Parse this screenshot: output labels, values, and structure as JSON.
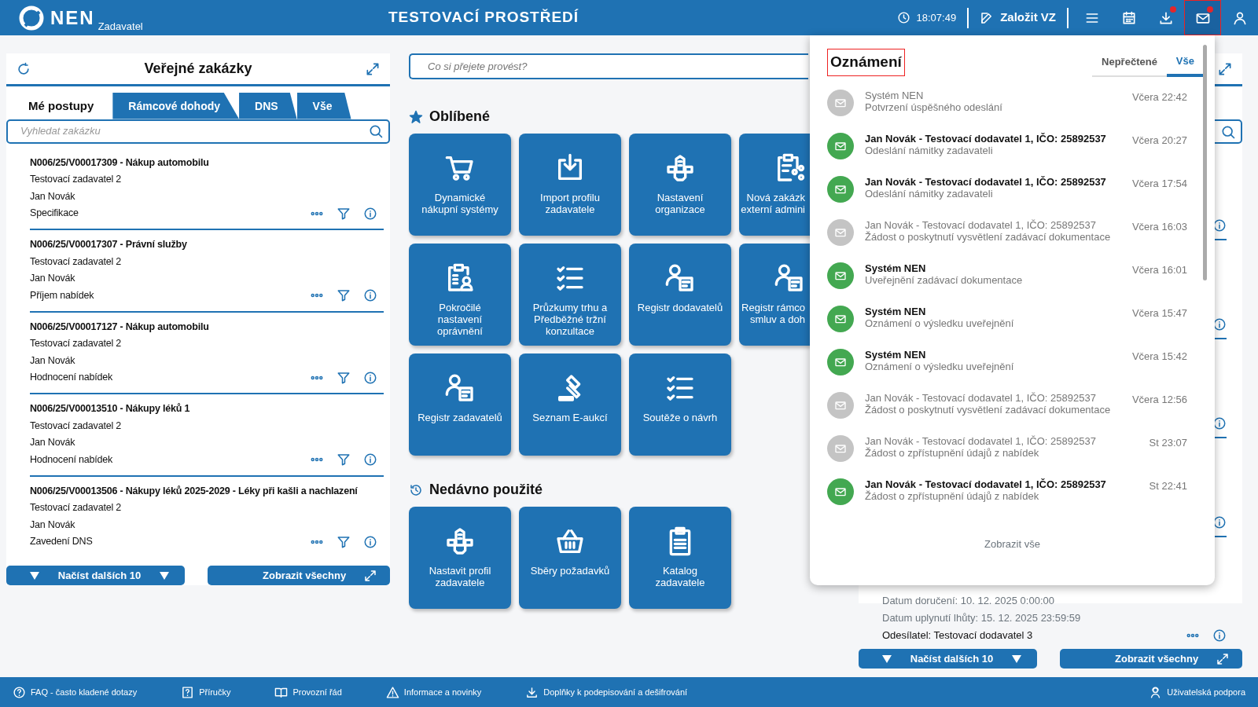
{
  "header": {
    "logo": "NEN",
    "logo_sub": "Zadavatel",
    "env_title": "TESTOVACÍ PROSTŘEDÍ",
    "time": "18:07:49",
    "create_button": "Založit VZ",
    "icon_buttons": [
      {
        "badge": false,
        "selected": false
      },
      {
        "badge": false,
        "selected": false
      },
      {
        "badge": true,
        "selected": false
      },
      {
        "badge": true,
        "selected": true
      },
      {
        "badge": false,
        "selected": false
      }
    ]
  },
  "left_panel": {
    "title": "Veřejné zakázky",
    "tabs": [
      {
        "label": "Mé postupy",
        "selected": true
      },
      {
        "label": "Rámcové dohody",
        "selected": false
      },
      {
        "label": "DNS",
        "selected": false
      },
      {
        "label": "Vše",
        "selected": false
      }
    ],
    "search": {
      "placeholder": "Vyhledat zakázku"
    },
    "items": [
      {
        "title": "N006/25/V00017309 - Nákup automobilu",
        "org": "Testovací zadavatel 2",
        "person": "Jan Novák",
        "phase": "Specifikace"
      },
      {
        "title": "N006/25/V00017307 - Právní služby",
        "org": "Testovací zadavatel 2",
        "person": "Jan Novák",
        "phase": "Příjem nabídek"
      },
      {
        "title": "N006/25/V00017127 - Nákup automobilu",
        "org": "Testovací zadavatel 2",
        "person": "Jan Novák",
        "phase": "Hodnocení nabídek"
      },
      {
        "title": "N006/25/V00013510 - Nákupy léků 1",
        "org": "Testovací zadavatel 2",
        "person": "Jan Novák",
        "phase": "Hodnocení nabídek"
      },
      {
        "title": "N006/25/V00013506 - Nákupy léků 2025-2029 - Léky při kašli a nachlazení",
        "org": "Testovací zadavatel 2",
        "person": "Jan Novák",
        "phase": "Zavedení DNS"
      }
    ],
    "load_more": "Načíst dalších 10",
    "show_all": "Zobrazit všechny"
  },
  "center": {
    "search": {
      "placeholder": "Co si přejete provést?"
    },
    "favorites": {
      "title": "Oblíbené",
      "tiles": [
        {
          "label": "Dynamické nákupní systémy",
          "cut": false
        },
        {
          "label": "Import profilu zadavatele",
          "cut": false
        },
        {
          "label": "Nastavení organizace",
          "cut": false
        },
        {
          "label": "Nová zakázk\nexterní admini",
          "cut": true
        },
        {
          "label": "Pokročilé nastavení oprávnění",
          "cut": false
        },
        {
          "label": "Průzkumy trhu a Předběžné tržní konzultace",
          "cut": false
        },
        {
          "label": "Registr dodavatelů",
          "cut": false
        },
        {
          "label": "Registr rámco\nsmluv a doh",
          "cut": true
        },
        {
          "label": "Registr zadavatelů",
          "cut": false
        },
        {
          "label": "Seznam E-aukcí",
          "cut": false
        },
        {
          "label": "Soutěže o návrh",
          "cut": false
        }
      ]
    },
    "recent": {
      "title": "Nedávno použité",
      "tiles": [
        {
          "label": "Nastavit profil zadavatele",
          "cut": false
        },
        {
          "label": "Sběry požadavků",
          "cut": false
        },
        {
          "label": "Katalog zadavatele",
          "cut": false
        }
      ]
    }
  },
  "right_panel": {
    "delivered": "Datum doručení: 10. 12. 2025 0:00:00",
    "deadline": "Datum uplynutí lhůty: 15. 12. 2025 23:59:59",
    "sender": "Odesílatel: Testovací dodavatel 3",
    "load_more": "Načíst dalších 10",
    "show_all": "Zobrazit všechny"
  },
  "notifications": {
    "title": "Oznámení",
    "tabs": [
      {
        "label": "Nepřečtené",
        "selected": false
      },
      {
        "label": "Vše",
        "selected": true
      }
    ],
    "items": [
      {
        "sender": "Systém NEN",
        "subject": "Potvrzení úspěšného odeslání",
        "time": "Včera 22:42",
        "unread": false
      },
      {
        "sender": "Jan Novák - Testovací dodavatel 1, IČO: 25892537",
        "subject": "Odeslání námitky zadavateli",
        "time": "Včera 20:27",
        "unread": true
      },
      {
        "sender": "Jan Novák - Testovací dodavatel 1, IČO: 25892537",
        "subject": "Odeslání námitky zadavateli",
        "time": "Včera 17:54",
        "unread": true
      },
      {
        "sender": "Jan Novák - Testovací dodavatel 1, IČO: 25892537",
        "subject": "Žádost o poskytnutí vysvětlení zadávací dokumentace",
        "time": "Včera 16:03",
        "unread": false
      },
      {
        "sender": "Systém NEN",
        "subject": "Uveřejnění zadávací dokumentace",
        "time": "Včera 16:01",
        "unread": true
      },
      {
        "sender": "Systém NEN",
        "subject": "Oznámení o výsledku uveřejnění",
        "time": "Včera 15:47",
        "unread": true
      },
      {
        "sender": "Systém NEN",
        "subject": "Oznámení o výsledku uveřejnění",
        "time": "Včera 15:42",
        "unread": true
      },
      {
        "sender": "Jan Novák - Testovací dodavatel 1, IČO: 25892537",
        "subject": "Žádost o poskytnutí vysvětlení zadávací dokumentace",
        "time": "Včera 12:56",
        "unread": false
      },
      {
        "sender": "Jan Novák - Testovací dodavatel 1, IČO: 25892537",
        "subject": "Žádost o zpřístupnění údajů z nabídek",
        "time": "St 23:07",
        "unread": false
      },
      {
        "sender": "Jan Novák - Testovací dodavatel 1, IČO: 25892537",
        "subject": "Žádost o zpřístupnění údajů z nabídek",
        "time": "St 22:41",
        "unread": true
      }
    ],
    "show_all": "Zobrazit vše"
  },
  "footer": {
    "links": [
      "FAQ - často kladené dotazy",
      "Příručky",
      "Provozní řád",
      "Informace a novinky",
      "Doplňky k podepisování a dešifrování"
    ],
    "support": "Uživatelská podpora"
  }
}
